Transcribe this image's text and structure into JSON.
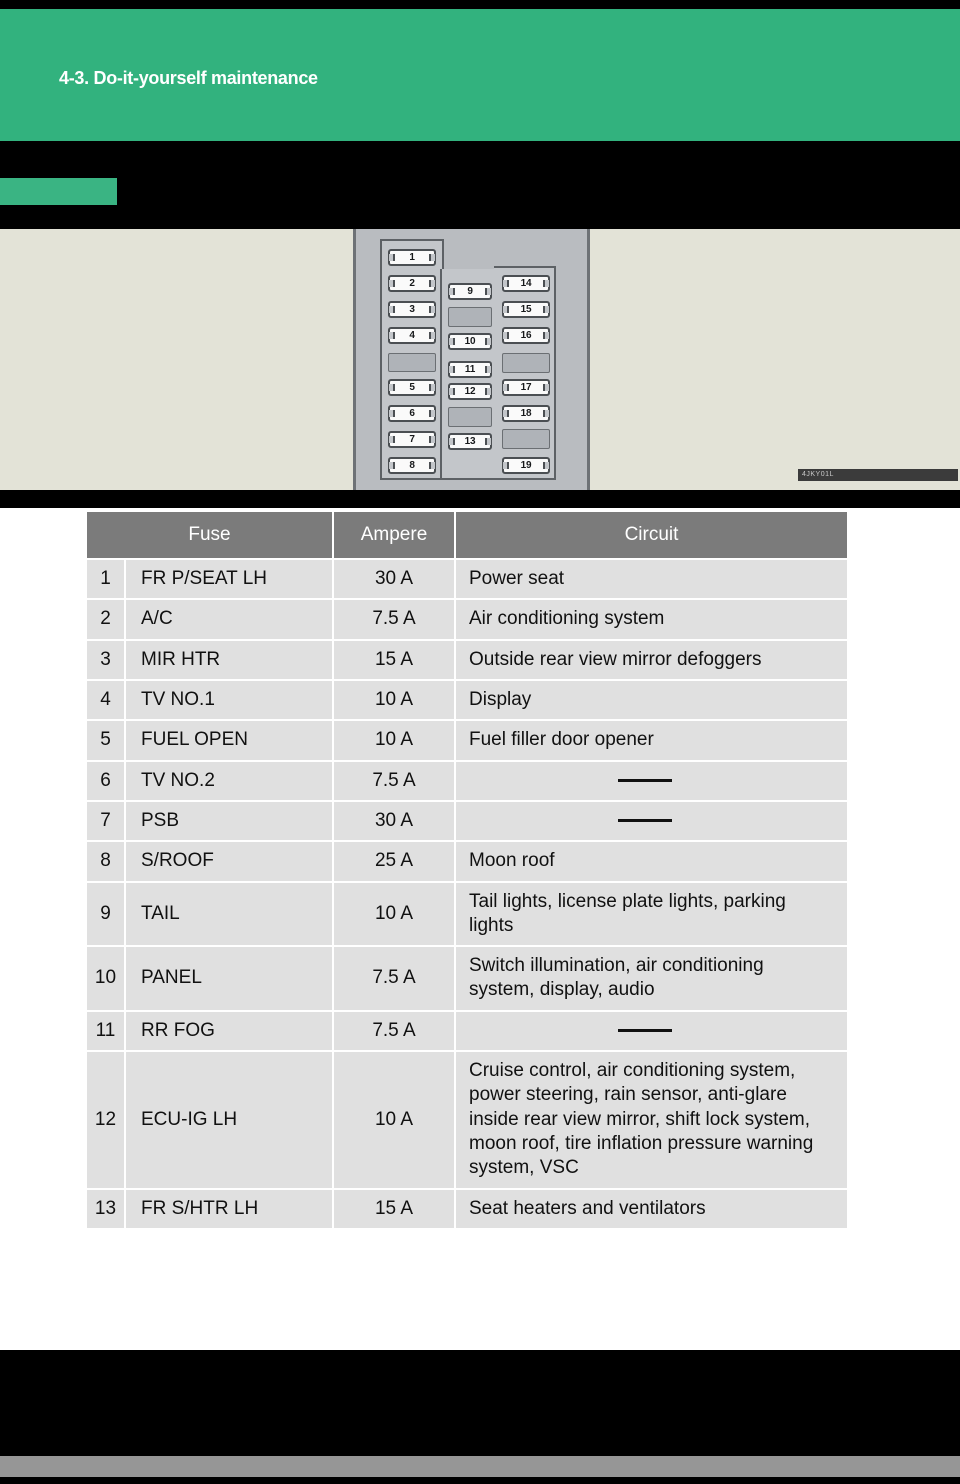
{
  "page": {
    "chapter_heading": "4-3. Do-it-yourself maintenance",
    "background_color": "#000000",
    "header_color": "#32B27E",
    "illustration_bg_color": "#E3E3D7",
    "table_header_color": "#7B7B7B",
    "table_row_color": "#E0E0E0",
    "footer_color": "#969696"
  },
  "illustration": {
    "name": "fuse-box-diagram",
    "watermark": "4JKY01L",
    "numbered_slots": [
      {
        "label": "1",
        "column": "left"
      },
      {
        "label": "2",
        "column": "left"
      },
      {
        "label": "3",
        "column": "left"
      },
      {
        "label": "4",
        "column": "left"
      },
      {
        "label": "5",
        "column": "left"
      },
      {
        "label": "6",
        "column": "left"
      },
      {
        "label": "7",
        "column": "left"
      },
      {
        "label": "8",
        "column": "left"
      },
      {
        "label": "9",
        "column": "middle"
      },
      {
        "label": "10",
        "column": "middle"
      },
      {
        "label": "11",
        "column": "middle"
      },
      {
        "label": "12",
        "column": "middle"
      },
      {
        "label": "13",
        "column": "middle"
      },
      {
        "label": "14",
        "column": "right"
      },
      {
        "label": "15",
        "column": "right"
      },
      {
        "label": "16",
        "column": "right"
      },
      {
        "label": "17",
        "column": "right"
      },
      {
        "label": "18",
        "column": "right"
      },
      {
        "label": "19",
        "column": "right"
      }
    ],
    "blank_slot_count": 5
  },
  "table": {
    "columns": [
      "Fuse",
      "Ampere",
      "Circuit"
    ],
    "rows": [
      {
        "no": "1",
        "fuse": "FR P/SEAT LH",
        "ampere": "30 A",
        "circuit": "Power seat"
      },
      {
        "no": "2",
        "fuse": "A/C",
        "ampere": "7.5 A",
        "circuit": "Air conditioning system"
      },
      {
        "no": "3",
        "fuse": "MIR HTR",
        "ampere": "15 A",
        "circuit": "Outside rear view mirror defoggers"
      },
      {
        "no": "4",
        "fuse": "TV NO.1",
        "ampere": "10 A",
        "circuit": "Display"
      },
      {
        "no": "5",
        "fuse": "FUEL OPEN",
        "ampere": "10 A",
        "circuit": "Fuel filler door opener"
      },
      {
        "no": "6",
        "fuse": "TV NO.2",
        "ampere": "7.5 A",
        "circuit": ""
      },
      {
        "no": "7",
        "fuse": "PSB",
        "ampere": "30 A",
        "circuit": ""
      },
      {
        "no": "8",
        "fuse": "S/ROOF",
        "ampere": "25 A",
        "circuit": "Moon roof"
      },
      {
        "no": "9",
        "fuse": "TAIL",
        "ampere": "10 A",
        "circuit": "Tail lights, license plate lights, parking lights"
      },
      {
        "no": "10",
        "fuse": "PANEL",
        "ampere": "7.5 A",
        "circuit": "Switch illumination, air conditioning system, display, audio"
      },
      {
        "no": "11",
        "fuse": "RR FOG",
        "ampere": "7.5 A",
        "circuit": ""
      },
      {
        "no": "12",
        "fuse": "ECU-IG LH",
        "ampere": "10 A",
        "circuit": "Cruise control, air conditioning system, power steering, rain sensor, anti-glare inside rear view mirror, shift lock system, moon roof, tire inflation pressure warning system, VSC"
      },
      {
        "no": "13",
        "fuse": "FR S/HTR LH",
        "ampere": "15 A",
        "circuit": "Seat heaters and ventilators"
      }
    ]
  }
}
